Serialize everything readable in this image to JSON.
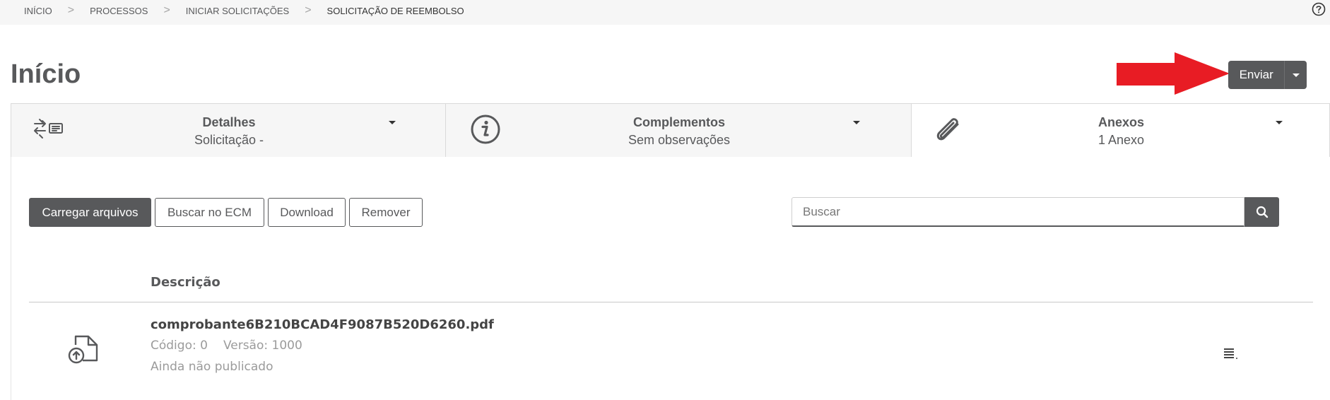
{
  "breadcrumb": {
    "items": [
      "INÍCIO",
      "PROCESSOS",
      "INICIAR SOLICITAÇÕES",
      "SOLICITAÇÃO DE REEMBOLSO"
    ],
    "separator": ">"
  },
  "page": {
    "title": "Início"
  },
  "actions": {
    "send_label": "Enviar",
    "highlight_color": "#e81c24"
  },
  "tabs": [
    {
      "title": "Detalhes",
      "subtitle": "Solicitação -",
      "icon": "transfer-icon"
    },
    {
      "title": "Complementos",
      "subtitle": "Sem observações",
      "icon": "info-icon"
    },
    {
      "title": "Anexos",
      "subtitle": "1 Anexo",
      "icon": "paperclip-icon",
      "active": true
    }
  ],
  "toolbar": {
    "upload_label": "Carregar arquivos",
    "ecm_label": "Buscar no ECM",
    "download_label": "Download",
    "remove_label": "Remover"
  },
  "search": {
    "placeholder": "Buscar",
    "value": ""
  },
  "table": {
    "column": "Descrição",
    "rows": [
      {
        "name": "comprobante6B210BCAD4F9087B520D6260.pdf",
        "code": "Código: 0",
        "version": "Versão: 1000",
        "status": "Ainda não publicado"
      }
    ]
  },
  "colors": {
    "primary": "#58595b",
    "tab_bg": "#f6f6f6"
  }
}
